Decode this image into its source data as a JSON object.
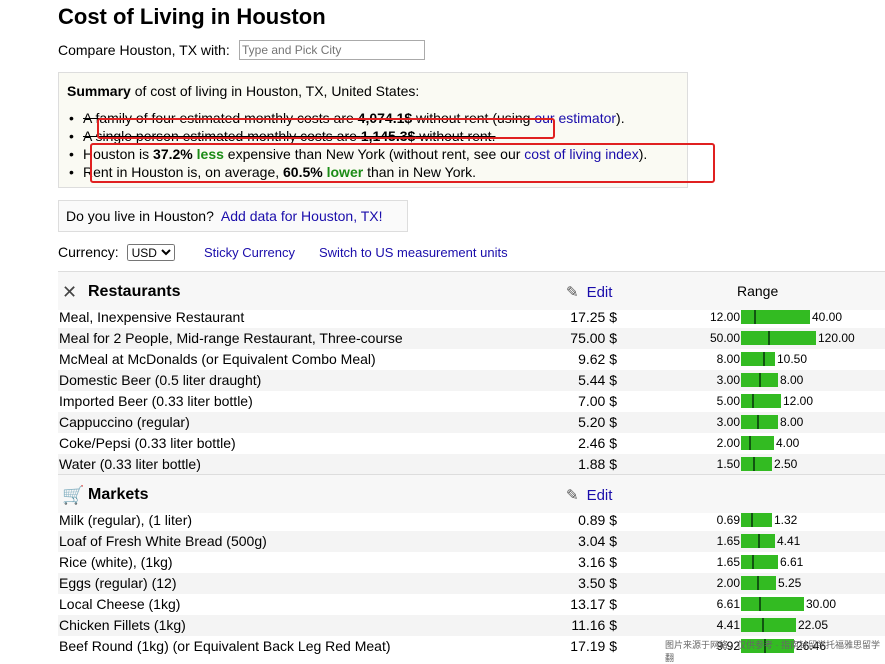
{
  "page": {
    "title": "Cost of Living in Houston"
  },
  "compare": {
    "label": "Compare Houston, TX with:",
    "placeholder": "Type and Pick City"
  },
  "summary": {
    "heading_bold": "Summary",
    "heading_rest": " of cost of living in Houston, TX, United States:",
    "family": {
      "pre": "A family of four estimated monthly costs are ",
      "value": "4,074.1$",
      "mid": " without rent (using ",
      "link": "our estimator",
      "post": ")."
    },
    "single": {
      "pre": "A single person estimated monthly costs are ",
      "value": "1,145.3$",
      "post": " without rent."
    },
    "vs_ny": {
      "pre": "Houston is ",
      "pct": "37.2%",
      "word": "less",
      "mid": " expensive than New York (without rent, see our ",
      "link": "cost of living index",
      "post": ")."
    },
    "rent": {
      "pre": "Rent in Houston is, on average, ",
      "pct": "60.5%",
      "word": "lower",
      "post": " than in New York."
    }
  },
  "live": {
    "question": "Do you live in Houston?",
    "link": "Add data for Houston, TX!"
  },
  "currency": {
    "label": "Currency:",
    "selected": "USD",
    "sticky": "Sticky Currency",
    "units": "Switch to US measurement units"
  },
  "sections": {
    "restaurants": {
      "title": "Restaurants",
      "edit": "Edit",
      "range": "Range",
      "rows": [
        {
          "item": "Meal, Inexpensive Restaurant",
          "price": "17.25 $",
          "lo": "12.00",
          "hi": "40.00"
        },
        {
          "item": "Meal for 2 People, Mid-range Restaurant, Three-course",
          "price": "75.00 $",
          "lo": "50.00",
          "hi": "120.00"
        },
        {
          "item": "McMeal at McDonalds (or Equivalent Combo Meal)",
          "price": "9.62 $",
          "lo": "8.00",
          "hi": "10.50"
        },
        {
          "item": "Domestic Beer (0.5 liter draught)",
          "price": "5.44 $",
          "lo": "3.00",
          "hi": "8.00"
        },
        {
          "item": "Imported Beer (0.33 liter bottle)",
          "price": "7.00 $",
          "lo": "5.00",
          "hi": "12.00"
        },
        {
          "item": "Cappuccino (regular)",
          "price": "5.20 $",
          "lo": "3.00",
          "hi": "8.00"
        },
        {
          "item": "Coke/Pepsi (0.33 liter bottle)",
          "price": "2.46 $",
          "lo": "2.00",
          "hi": "4.00"
        },
        {
          "item": "Water (0.33 liter bottle)",
          "price": "1.88 $",
          "lo": "1.50",
          "hi": "2.50"
        }
      ]
    },
    "markets": {
      "title": "Markets",
      "edit": "Edit",
      "rows": [
        {
          "item": "Milk (regular), (1 liter)",
          "price": "0.89 $",
          "lo": "0.69",
          "hi": "1.32"
        },
        {
          "item": "Loaf of Fresh White Bread (500g)",
          "price": "3.04 $",
          "lo": "1.65",
          "hi": "4.41"
        },
        {
          "item": "Rice (white), (1kg)",
          "price": "3.16 $",
          "lo": "1.65",
          "hi": "6.61"
        },
        {
          "item": "Eggs (regular) (12)",
          "price": "3.50 $",
          "lo": "2.00",
          "hi": "5.25"
        },
        {
          "item": "Local Cheese (1kg)",
          "price": "13.17 $",
          "lo": "6.61",
          "hi": "30.00"
        },
        {
          "item": "Chicken Fillets (1kg)",
          "price": "11.16 $",
          "lo": "4.41",
          "hi": "22.05"
        },
        {
          "item": "Beef Round (1kg) (or Equivalent Back Leg Red Meat)",
          "price": "17.19 $",
          "lo": "9.92",
          "hi": "26.46"
        }
      ]
    }
  },
  "watermark": "图片来源于网络，仅供参考 · 指南针留学托福雅思留学翻"
}
